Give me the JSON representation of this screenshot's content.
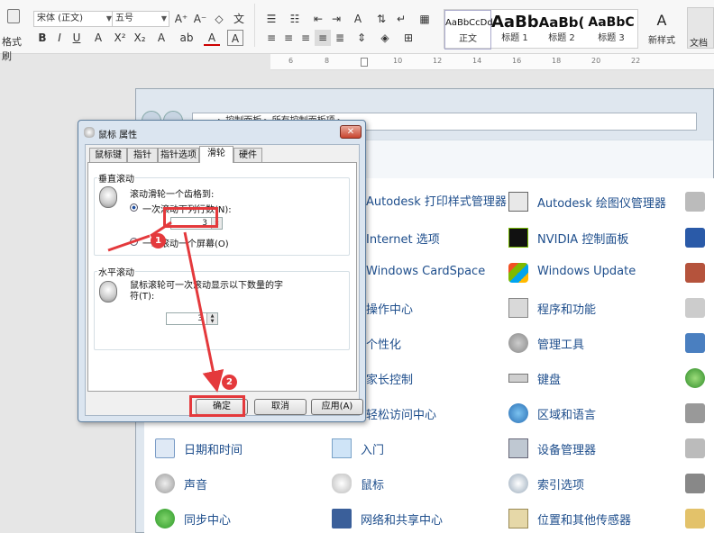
{
  "ribbon": {
    "left_label": "格式刷",
    "font_name": "宋体 (正文)",
    "font_size": "五号",
    "styles": [
      {
        "preview": "AaBbCcDd",
        "name": "正文"
      },
      {
        "preview": "AaBb",
        "name": "标题 1"
      },
      {
        "preview": "AaBb(",
        "name": "标题 2"
      },
      {
        "preview": "AaBbC",
        "name": "标题 3"
      }
    ],
    "new_style_label": "新样式",
    "right_label": "文档"
  },
  "ruler": {
    "ticks": [
      "6",
      "8",
      "10",
      "12",
      "14",
      "16",
      "18",
      "20",
      "22"
    ]
  },
  "control_panel": {
    "breadcrumb": "▸ 控制面板 ▸ 所有控制面板项 ▸",
    "items_col1": [
      {
        "name": "Autodesk 打印样式管理器",
        "icon": "printer-style-icon"
      },
      {
        "name": "Internet 选项",
        "icon": "internet-options-icon"
      },
      {
        "name": "Windows CardSpace",
        "icon": "cardspace-icon"
      },
      {
        "name": "操作中心",
        "icon": "action-center-icon"
      },
      {
        "name": "个性化",
        "icon": "personalization-icon"
      },
      {
        "name": "家长控制",
        "icon": "parental-control-icon"
      },
      {
        "name": "轻松访问中心",
        "icon": "ease-of-access-icon"
      }
    ],
    "items_col0": [
      {
        "name": "日期和时间",
        "icon": "calendar-clock-icon"
      },
      {
        "name": "声音",
        "icon": "speaker-icon"
      },
      {
        "name": "同步中心",
        "icon": "sync-icon"
      }
    ],
    "items_col1_lower": [
      {
        "name": "入门",
        "icon": "getting-started-icon"
      },
      {
        "name": "鼠标",
        "icon": "mouse-icon"
      },
      {
        "name": "网络和共享中心",
        "icon": "network-icon"
      }
    ],
    "items_col2": [
      {
        "name": "Autodesk 绘图仪管理器",
        "icon": "plotter-icon"
      },
      {
        "name": "NVIDIA 控制面板",
        "icon": "nvidia-icon"
      },
      {
        "name": "Windows Update",
        "icon": "windows-update-icon"
      },
      {
        "name": "程序和功能",
        "icon": "programs-icon"
      },
      {
        "name": "管理工具",
        "icon": "admin-tools-icon"
      },
      {
        "name": "键盘",
        "icon": "keyboard-icon"
      },
      {
        "name": "区域和语言",
        "icon": "region-language-icon"
      },
      {
        "name": "设备管理器",
        "icon": "device-manager-icon"
      },
      {
        "name": "索引选项",
        "icon": "indexing-icon"
      },
      {
        "name": "位置和其他传感器",
        "icon": "location-sensor-icon"
      }
    ]
  },
  "dialog": {
    "title": "鼠标 属性",
    "tabs": [
      "鼠标键",
      "指针",
      "指针选项",
      "滑轮",
      "硬件"
    ],
    "active_tab": "滑轮",
    "vertical_group": {
      "title": "垂直滚动",
      "desc": "滚动滑轮一个齿格到:",
      "option1": "一次滚动下列行数(N):",
      "option1_value": "3",
      "option2": "一次滚动一个屏幕(O)"
    },
    "horizontal_group": {
      "title": "水平滚动",
      "desc": "鼠标滚轮可一次滚动显示以下数量的字符(T):",
      "value": "3"
    },
    "buttons": {
      "ok": "确定",
      "cancel": "取消",
      "apply": "应用(A)"
    }
  },
  "annotations": {
    "marker1": "1",
    "marker2": "2",
    "color": "#e4393c"
  }
}
